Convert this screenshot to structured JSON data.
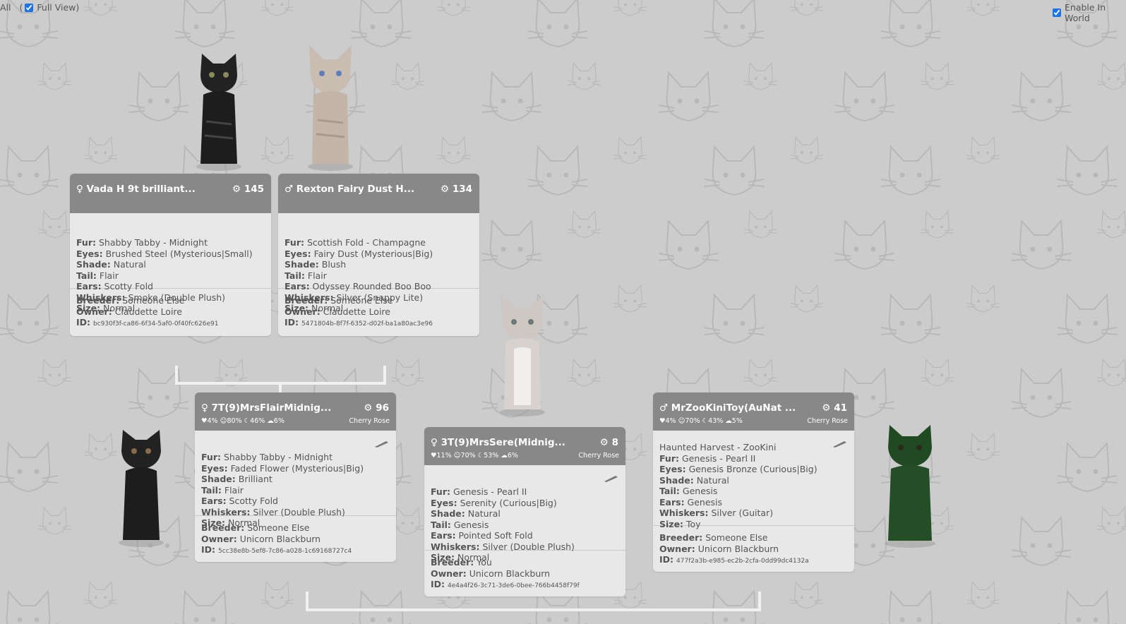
{
  "topbar": {
    "show_all": "All",
    "open_paren": "(",
    "full_view": "Full View)",
    "enable_world": "Enable In World"
  },
  "colors": {
    "background": "#cccccc",
    "header": "#888888",
    "card": "#e8e8e8",
    "connector": "#f1f1f1",
    "checkbox": "#1a73e8"
  },
  "cats": [
    {
      "sex": "♀",
      "name": "Vada H 9t brilliant...",
      "count": "145",
      "fur": "Shabby Tabby - Midnight",
      "eyes": "Brushed Steel (Mysterious|Small)",
      "shade": "Natural",
      "tail": "Flair",
      "ears": "Scotty Fold",
      "whiskers": "Smoke (Double Plush)",
      "size": "Normal",
      "breeder": "Someone Else",
      "owner": "Claudette Loire",
      "id": "bc930f3f-ca86-6f34-5af0-0f40fc626e91"
    },
    {
      "sex": "♂",
      "name": "Rexton Fairy Dust H...",
      "count": "134",
      "fur": "Scottish Fold - Champagne",
      "eyes": "Fairy Dust (Mysterious|Big)",
      "shade": "Blush",
      "tail": "Flair",
      "ears": "Odyssey Rounded Boo Boo",
      "whiskers": "Silver (Snappy Lite)",
      "size": "Normal",
      "breeder": "Someone Else",
      "owner": "Claudette Loire",
      "id": "5471804b-8f7f-6352-d02f-ba1a80ac3e96"
    },
    {
      "sex": "♀",
      "name": "7T(9)MrsFlairMidnig...",
      "count": "96",
      "stats": "♥4%  ☺80%  ☾46%  ☁6%",
      "farm": "Cherry Rose",
      "fur": "Shabby Tabby - Midnight",
      "eyes": "Faded Flower (Mysterious|Big)",
      "shade": "Brilliant",
      "tail": "Flair",
      "ears": "Scotty Fold",
      "whiskers": "Silver (Double Plush)",
      "size": "Normal",
      "breeder": "Someone Else",
      "owner": "Unicorn Blackburn",
      "id": "5cc38e8b-5ef8-7c86-a028-1c69168727c4"
    },
    {
      "sex": "♀",
      "name": "3T(9)MrsSere(Midnig...",
      "count": "8",
      "stats": "♥11%  ☺70%  ☾53%  ☁6%",
      "farm": "Cherry Rose",
      "fur": "Genesis - Pearl II",
      "eyes": "Serenity (Curious|Big)",
      "shade": "Natural",
      "tail": "Genesis",
      "ears": "Pointed Soft Fold",
      "whiskers": "Silver (Double Plush)",
      "size": "Normal",
      "breeder": "You",
      "owner": "Unicorn Blackburn",
      "id": "4e4a4f26-3c71-3de6-0bee-766b4458f79f"
    },
    {
      "sex": "♂",
      "name": "MrZooKiniToy(AuNat ...",
      "count": "41",
      "stats": "♥4%  ☺70%  ☾43%  ☁5%",
      "farm": "Cherry Rose",
      "extra": "Haunted Harvest - ZooKini",
      "fur": "Genesis - Pearl II",
      "eyes": "Genesis Bronze (Curious|Big)",
      "shade": "Natural",
      "tail": "Genesis",
      "ears": "Genesis",
      "whiskers": "Silver (Guitar)",
      "size": "Toy",
      "breeder": "Someone Else",
      "owner": "Unicorn Blackburn",
      "id": "477f2a3b-e985-ec2b-2cfa-0dd99dc4132a"
    }
  ],
  "labels": {
    "fur": "Fur:",
    "eyes": "Eyes:",
    "shade": "Shade:",
    "tail": "Tail:",
    "ears": "Ears:",
    "whiskers": "Whiskers:",
    "size": "Size:",
    "breeder": "Breeder:",
    "owner": "Owner:",
    "id": "ID:"
  }
}
